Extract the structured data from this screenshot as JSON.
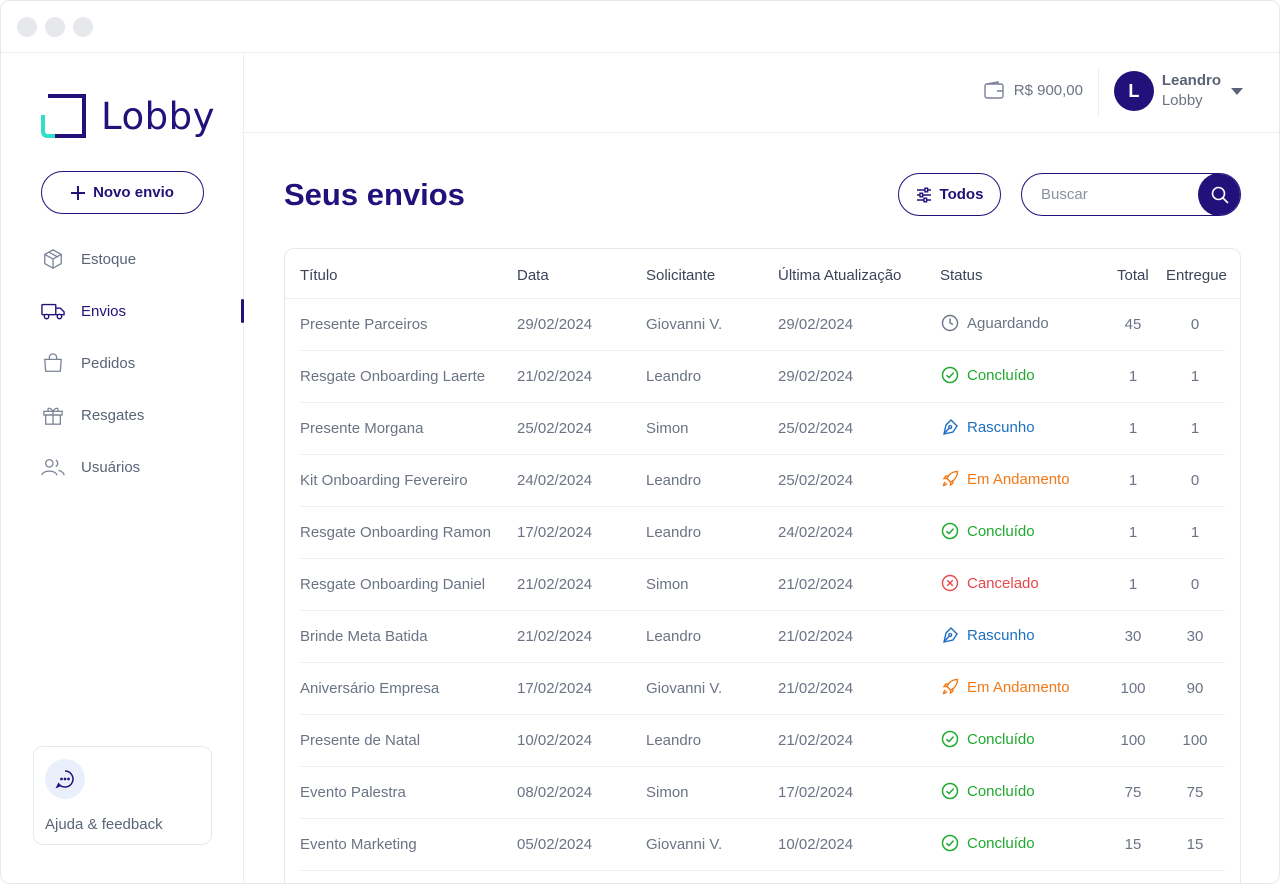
{
  "brand": {
    "name": "Lobby"
  },
  "sidebar": {
    "new_button": "Novo envio",
    "items": [
      {
        "label": "Estoque",
        "icon": "box-icon",
        "active": false
      },
      {
        "label": "Envios",
        "icon": "truck-icon",
        "active": true
      },
      {
        "label": "Pedidos",
        "icon": "shopping-bag-icon",
        "active": false
      },
      {
        "label": "Resgates",
        "icon": "gift-icon",
        "active": false
      },
      {
        "label": "Usuários",
        "icon": "users-icon",
        "active": false
      }
    ],
    "help_label": "Ajuda & feedback"
  },
  "header": {
    "balance": "R$ 900,00",
    "user": {
      "initial": "L",
      "name": "Leandro",
      "company": "Lobby"
    }
  },
  "main": {
    "title": "Seus envios",
    "filter_label": "Todos",
    "search_placeholder": "Buscar",
    "table": {
      "columns": [
        "Título",
        "Data",
        "Solicitante",
        "Última Atualização",
        "Status",
        "Total",
        "Entregue"
      ],
      "rows": [
        {
          "title": "Presente Parceiros",
          "date": "29/02/2024",
          "requester": "Giovanni V.",
          "updated": "29/02/2024",
          "status": "Aguardando",
          "status_type": "waiting",
          "total": "45",
          "delivered": "0"
        },
        {
          "title": "Resgate Onboarding Laerte",
          "date": "21/02/2024",
          "requester": "Leandro",
          "updated": "29/02/2024",
          "status": "Concluído",
          "status_type": "done",
          "total": "1",
          "delivered": "1"
        },
        {
          "title": "Presente Morgana",
          "date": "25/02/2024",
          "requester": "Simon",
          "updated": "25/02/2024",
          "status": "Rascunho",
          "status_type": "draft",
          "total": "1",
          "delivered": "1"
        },
        {
          "title": "Kit Onboarding Fevereiro",
          "date": "24/02/2024",
          "requester": "Leandro",
          "updated": "25/02/2024",
          "status": "Em Andamento",
          "status_type": "progress",
          "total": "1",
          "delivered": "0"
        },
        {
          "title": "Resgate Onboarding Ramon",
          "date": "17/02/2024",
          "requester": "Leandro",
          "updated": "24/02/2024",
          "status": "Concluído",
          "status_type": "done",
          "total": "1",
          "delivered": "1"
        },
        {
          "title": "Resgate Onboarding Daniel",
          "date": "21/02/2024",
          "requester": "Simon",
          "updated": "21/02/2024",
          "status": "Cancelado",
          "status_type": "cancelled",
          "total": "1",
          "delivered": "0"
        },
        {
          "title": "Brinde Meta Batida",
          "date": "21/02/2024",
          "requester": "Leandro",
          "updated": "21/02/2024",
          "status": "Rascunho",
          "status_type": "draft",
          "total": "30",
          "delivered": "30"
        },
        {
          "title": "Aniversário Empresa",
          "date": "17/02/2024",
          "requester": "Giovanni V.",
          "updated": "21/02/2024",
          "status": "Em Andamento",
          "status_type": "progress",
          "total": "100",
          "delivered": "90"
        },
        {
          "title": "Presente de Natal",
          "date": "10/02/2024",
          "requester": "Leandro",
          "updated": "21/02/2024",
          "status": "Concluído",
          "status_type": "done",
          "total": "100",
          "delivered": "100"
        },
        {
          "title": "Evento Palestra",
          "date": "08/02/2024",
          "requester": "Simon",
          "updated": "17/02/2024",
          "status": "Concluído",
          "status_type": "done",
          "total": "75",
          "delivered": "75"
        },
        {
          "title": "Evento Marketing",
          "date": "05/02/2024",
          "requester": "Giovanni V.",
          "updated": "10/02/2024",
          "status": "Concluído",
          "status_type": "done",
          "total": "15",
          "delivered": "15"
        }
      ]
    }
  },
  "colors": {
    "brand": "#22117a",
    "accent": "#2fe0c4",
    "waiting": "#6b7385",
    "done": "#1faa2e",
    "draft": "#1f6fbf",
    "progress": "#f07a1a",
    "cancelled": "#e5484d"
  }
}
